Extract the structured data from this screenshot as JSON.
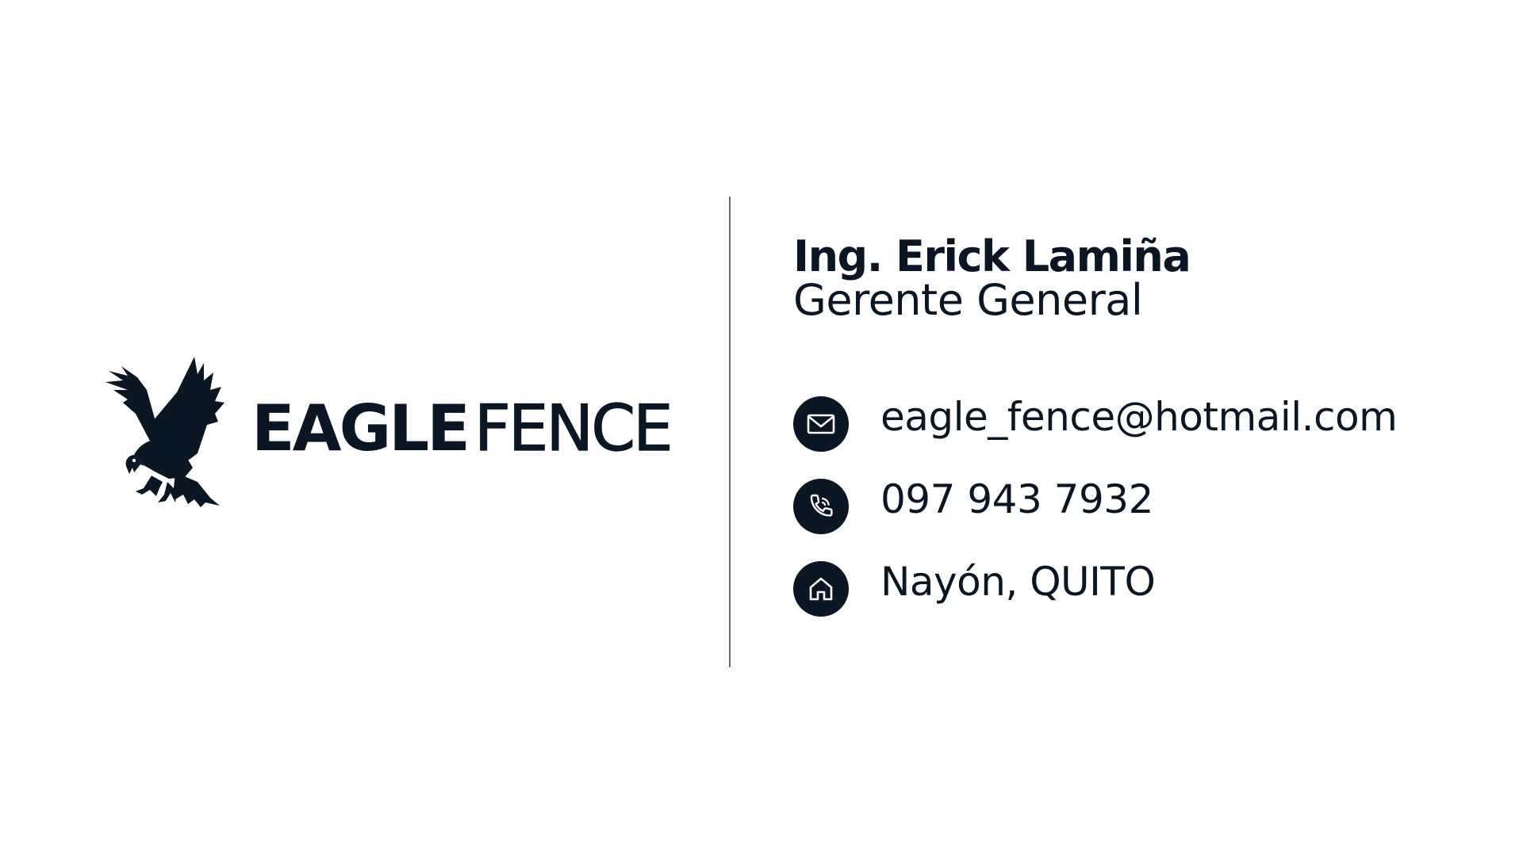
{
  "brand": {
    "word1": "EAGLE",
    "word2": "FENCE",
    "logo_icon": "eagle-icon",
    "color": "#0b1624"
  },
  "person": {
    "name": "Ing. Erick Lamiña",
    "role": "Gerente General"
  },
  "contacts": [
    {
      "icon": "mail-icon",
      "text": "eagle_fence@hotmail.com"
    },
    {
      "icon": "phone-icon",
      "text": "097 943 7932"
    },
    {
      "icon": "home-icon",
      "text": "Nayón, QUITO"
    }
  ],
  "colors": {
    "text": "#0b1624",
    "divider": "#6b7078",
    "background": "#ffffff"
  }
}
